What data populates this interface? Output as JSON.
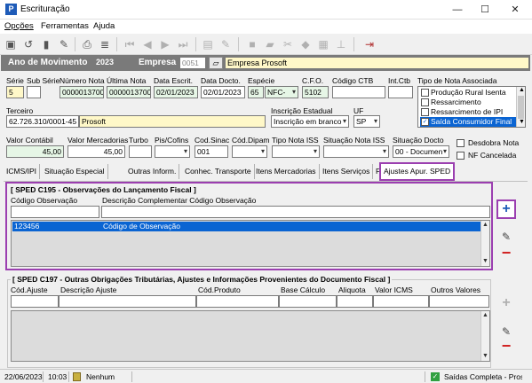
{
  "window": {
    "title": "Escrituração"
  },
  "menu": {
    "items": [
      "Opções",
      "Ferramentas",
      "Ajuda"
    ]
  },
  "header": {
    "ano_label": "Ano de Movimento",
    "ano_value": "2023",
    "empresa_label": "Empresa",
    "empresa_code": "0051",
    "empresa_name": "Empresa Prosoft"
  },
  "form": {
    "serie_label": "Série",
    "subserie_label": "Sub Série",
    "serie_value": "5",
    "numero_nota_label": "Número Nota",
    "numero_nota_value": "0000013700",
    "ultima_nota_label": "Última Nota",
    "ultima_nota_value": "0000013700",
    "data_escrit_label": "Data Escrit.",
    "data_escrit_value": "02/01/2023",
    "data_docto_label": "Data Docto.",
    "data_docto_value": "02/01/2023",
    "especie_label": "Espécie",
    "especie_code": "65",
    "especie_value": "NFC-",
    "cfo_label": "C.F.O.",
    "cfo_value": "5102",
    "codigo_ctb_label": "Código CTB",
    "int_ctb_label": "Int.Ctb",
    "terceiro_label": "Terceiro",
    "terceiro_doc": "62.726.310/0001-45",
    "terceiro_name": "Prosoft",
    "insc_estadual_label": "Inscrição Estadual",
    "insc_estadual_value": "Inscrição em branco",
    "uf_label": "UF",
    "uf_value": "SP",
    "tipo_nota_label": "Tipo de Nota Associada",
    "tipo_nota_items": [
      "Produção Rural Isenta",
      "Ressarcimento",
      "Ressarcimento de IPI",
      "Saída Consumidor Final"
    ],
    "valor_contabil_label": "Valor Contábil",
    "valor_contabil_value": "45,00",
    "valor_mercadorias_label": "Valor Mercadorias",
    "valor_mercadorias_value": "45,00",
    "turbo_label": "Turbo",
    "pis_cofins_label": "Pis/Cofins",
    "cod_sinac_label": "Cod.Sinac",
    "cod_sinac_value": "001",
    "cod_dipam_label": "Cód.Dipam",
    "tipo_nota_iss_label": "Tipo Nota ISS",
    "situacao_nota_iss_label": "Situação Nota ISS",
    "situacao_docto_label": "Situação Docto",
    "situacao_docto_value": "00 - Documen",
    "desdobra_nota_label": "Desdobra Nota",
    "nf_cancelada_label": "NF Cancelada"
  },
  "tabs": [
    "ICMS/IPI",
    "Situação Especial",
    "Outras Inform.",
    "Conhec. Transporte",
    "Itens Mercadorias",
    "Itens Serviços",
    "Faturas",
    "Ajustes Apur. SPED"
  ],
  "c195": {
    "title": "[ SPED C195 - Observações do Lançamento Fiscal ]",
    "col_codigo": "Código Observação",
    "col_descricao": "Descrição Complementar Código Observação",
    "rows": [
      {
        "codigo": "123456",
        "descricao": "Código de Observação"
      }
    ]
  },
  "c197": {
    "title": "[ SPED C197 - Outras Obrigações Tributárias, Ajustes e Informações Provenientes do Documento Fiscal ]",
    "cols": [
      "Cód.Ajuste",
      "Descrição Ajuste",
      "Cód.Produto",
      "Base Cálculo",
      "Aliquota",
      "Valor ICMS",
      "Outros Valores"
    ]
  },
  "status": {
    "date": "22/06/2023",
    "time": "10:03",
    "user": "Nenhum",
    "mode": "Saídas Completa - Pros"
  },
  "colors": {
    "highlight_purple": "#9b3fb0",
    "selection_blue": "#0a64d2",
    "gray_bar": "#7a7a7a"
  }
}
